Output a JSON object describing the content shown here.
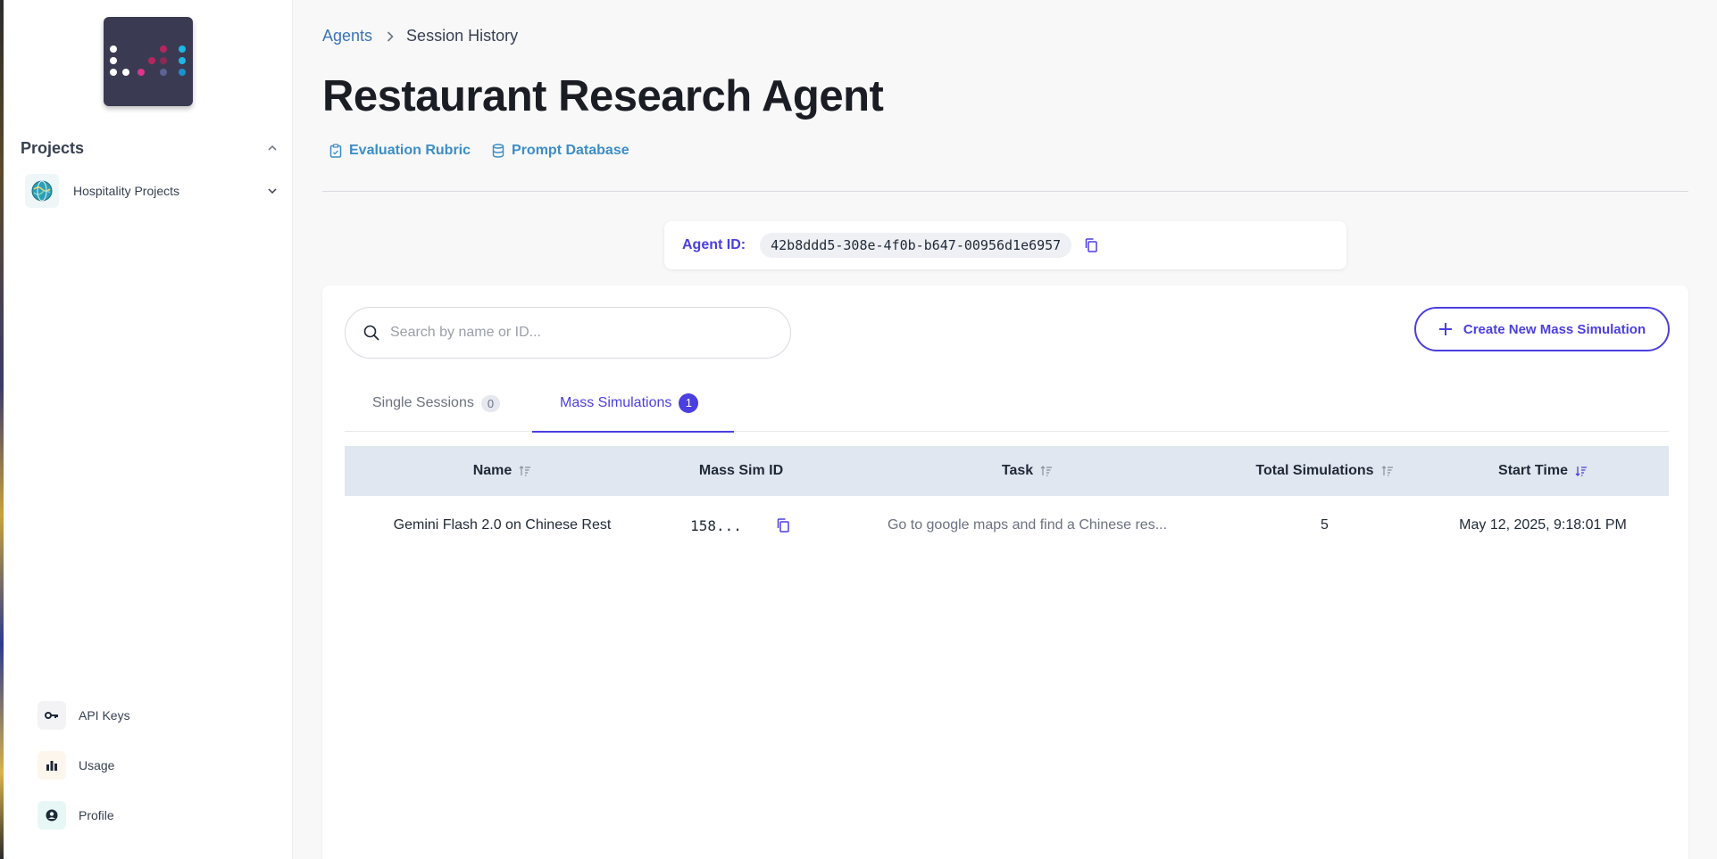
{
  "sidebar": {
    "projects_title": "Projects",
    "project": {
      "label": "Hospitality Projects"
    },
    "bottom_nav": [
      {
        "label": "API Keys",
        "icon": "key-icon",
        "bg": "#f3f3f6"
      },
      {
        "label": "Usage",
        "icon": "bar-chart-icon",
        "bg": "#fdf6ec"
      },
      {
        "label": "Profile",
        "icon": "user-circle-icon",
        "bg": "#e7f7f6"
      }
    ]
  },
  "breadcrumb": {
    "parent": "Agents",
    "current": "Session History"
  },
  "page": {
    "title": "Restaurant Research Agent",
    "links": [
      {
        "label": "Evaluation Rubric",
        "icon": "clipboard-icon"
      },
      {
        "label": "Prompt Database",
        "icon": "database-icon"
      }
    ]
  },
  "agent": {
    "id_label": "Agent ID:",
    "id_value": "42b8ddd5-308e-4f0b-b647-00956d1e6957"
  },
  "search": {
    "placeholder": "Search by name or ID...",
    "value": ""
  },
  "create_button": {
    "label": "Create New Mass Simulation"
  },
  "tabs": [
    {
      "label": "Single Sessions",
      "count": "0",
      "active": false
    },
    {
      "label": "Mass Simulations",
      "count": "1",
      "active": true
    }
  ],
  "table": {
    "columns": [
      "Name",
      "Mass Sim ID",
      "Task",
      "Total Simulations",
      "Start Time"
    ],
    "rows": [
      {
        "name": "Gemini Flash 2.0 on Chinese Rest",
        "mass_sim_id": "158...",
        "task": "Go to google maps and find a Chinese res...",
        "total_simulations": "5",
        "start_time": "May 12, 2025, 9:18:01 PM"
      }
    ]
  },
  "colors": {
    "accent": "#4b3fe0",
    "link": "#3b8ec8",
    "table_header": "#e1e7f0"
  }
}
